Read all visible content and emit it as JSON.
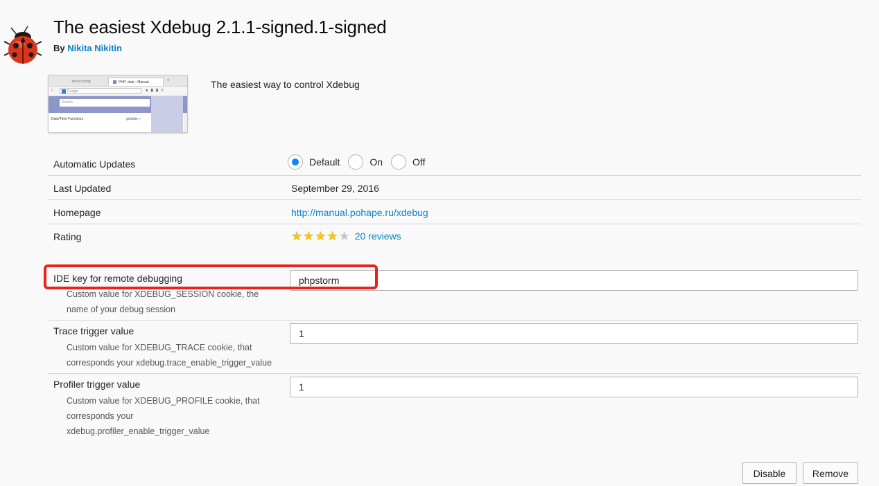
{
  "header": {
    "title": "The easiest Xdebug  2.1.1-signed.1-signed",
    "by_label": "By",
    "author": "Nikita Nikitin",
    "icon": "ladybug-icon"
  },
  "thumbnail": {
    "tab1": "about:config",
    "tab2": "PHP: date - Manual",
    "url_placeholder": "Google",
    "search_placeholder": "Search",
    "section": "Date/Time Functions",
    "link": "getdate »"
  },
  "description": "The easiest way to control Xdebug",
  "details": {
    "auto_updates": {
      "label": "Automatic Updates",
      "options": [
        "Default",
        "On",
        "Off"
      ],
      "selected": "Default"
    },
    "last_updated": {
      "label": "Last Updated",
      "value": "September 29, 2016"
    },
    "homepage": {
      "label": "Homepage",
      "value": "http://manual.pohape.ru/xdebug"
    },
    "rating": {
      "label": "Rating",
      "stars": 4,
      "max_stars": 5,
      "reviews": "20 reviews"
    }
  },
  "preferences": {
    "ide_key": {
      "label": "IDE key for remote debugging",
      "desc_line1": "Custom value for XDEBUG_SESSION cookie, the",
      "desc_line2": "name of your debug session",
      "value": "phpstorm"
    },
    "trace": {
      "label": "Trace trigger value",
      "desc_line1": "Custom value for XDEBUG_TRACE cookie, that",
      "desc_line2": "corresponds your xdebug.trace_enable_trigger_value",
      "value": "1"
    },
    "profiler": {
      "label": "Profiler trigger value",
      "desc_line1": "Custom value for XDEBUG_PROFILE cookie, that",
      "desc_line2": "corresponds your",
      "desc_line3": "xdebug.profiler_enable_trigger_value",
      "value": "1"
    }
  },
  "buttons": {
    "disable": "Disable",
    "remove": "Remove"
  },
  "colors": {
    "link": "#0a84c6",
    "radio_checked": "#0a84ff",
    "highlight": "#e8231a"
  }
}
